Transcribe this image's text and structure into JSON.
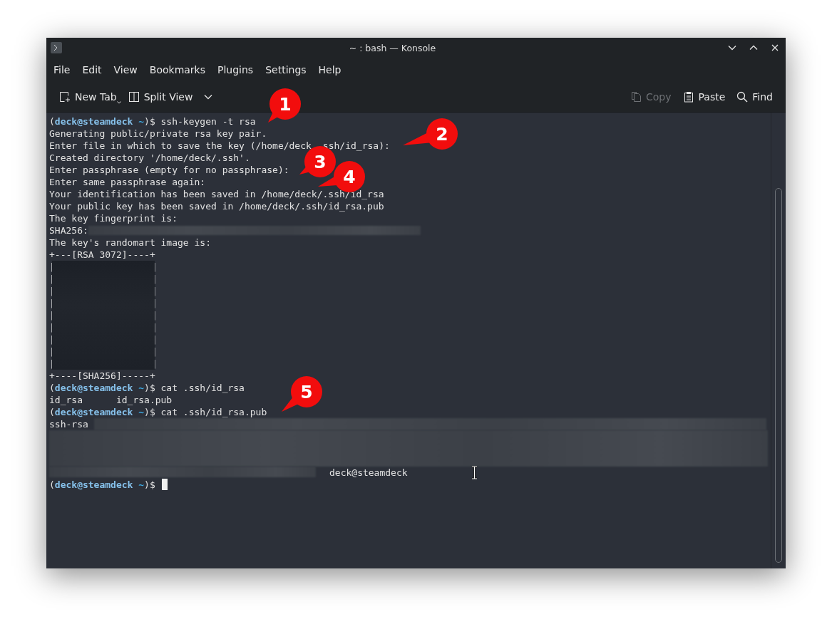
{
  "window": {
    "title": "~ : bash — Konsole"
  },
  "menu": [
    "File",
    "Edit",
    "View",
    "Bookmarks",
    "Plugins",
    "Settings",
    "Help"
  ],
  "toolbar": [
    {
      "kind": "new_tab",
      "label": "New Tab",
      "disabled": false
    },
    {
      "kind": "split_view",
      "label": "Split View",
      "disabled": false
    },
    {
      "kind": "copy",
      "label": "Copy",
      "disabled": true
    },
    {
      "kind": "paste",
      "label": "Paste",
      "disabled": false
    },
    {
      "kind": "find",
      "label": "Find",
      "disabled": false
    }
  ],
  "terminal": {
    "lines": [
      {
        "kind": "prompt",
        "open": "(",
        "user": "deck@steamdeck",
        "path": "~",
        "close": ")$",
        "command": "ssh-keygen -t rsa",
        "cursor": false
      },
      {
        "kind": "output",
        "text": "Generating public/private rsa key pair."
      },
      {
        "kind": "split",
        "parts": [
          "Enter file in which to save the key (/home/deck",
          "ssh/id_rsa):"
        ]
      },
      {
        "kind": "output",
        "text": "Created directory '/home/deck/.ssh'."
      },
      {
        "kind": "output",
        "text": "Enter passphrase (empty for no passphrase):"
      },
      {
        "kind": "output",
        "text": "Enter same passphrase again:"
      },
      {
        "kind": "output",
        "text": "Your identification has been saved in /home/deck/.ssh/id_rsa"
      },
      {
        "kind": "output",
        "text": "Your public key has been saved in /home/deck/.ssh/id_rsa.pub"
      },
      {
        "kind": "output",
        "text": "The key fingerprint is:"
      },
      {
        "kind": "redacted",
        "text": "SHA256:"
      },
      {
        "kind": "output",
        "text": "The key's randomart image is:"
      },
      {
        "kind": "randomart",
        "top": "+---[RSA 3072]----+",
        "rows": [
          [
            "|",
            "|"
          ],
          [
            "|",
            "|"
          ],
          [
            "|",
            "|"
          ],
          [
            "|",
            "|"
          ],
          [
            "|",
            "|"
          ],
          [
            "|",
            "|"
          ],
          [
            "|",
            "|"
          ],
          [
            "|",
            "|"
          ],
          [
            "|",
            "|"
          ]
        ],
        "bottom": "+----[SHA256]-----+"
      },
      {
        "kind": "prompt",
        "open": "(",
        "user": "deck@steamdeck",
        "path": "~",
        "close": ")$",
        "command": "cat .ssh/id_rsa",
        "cursor": false
      },
      {
        "kind": "output",
        "text": "id_rsa      id_rsa.pub"
      },
      {
        "kind": "prompt",
        "open": "(",
        "user": "deck@steamdeck",
        "path": "~",
        "close": ")$",
        "command": "cat .ssh/id_rsa.pub",
        "cursor": false
      },
      {
        "kind": "pubkey",
        "prefix": "ssh-rsa",
        "suffix": "deck@steamdeck"
      },
      {
        "kind": "prompt",
        "open": "(",
        "user": "deck@steamdeck",
        "path": "~",
        "close": ")$",
        "cursor": true
      }
    ]
  },
  "callouts": [
    "1",
    "2",
    "3",
    "4",
    "5"
  ]
}
